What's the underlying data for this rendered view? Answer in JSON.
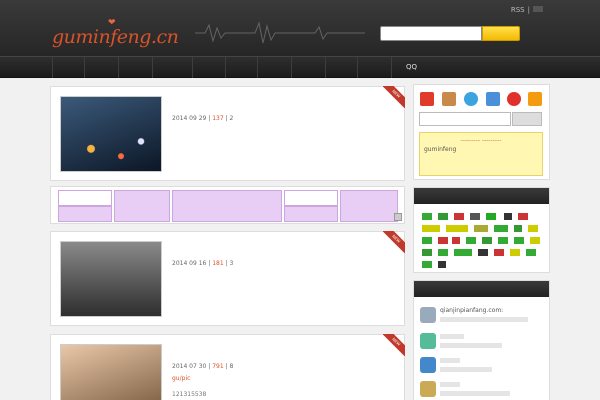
{
  "header": {
    "logo": "guminfeng.cn",
    "top_links": [
      "RSS",
      ""
    ],
    "search_value": "",
    "search_button": ""
  },
  "nav": {
    "items": [
      "",
      "",
      "",
      "",
      "",
      "",
      "",
      "",
      "",
      "",
      "QQ"
    ]
  },
  "posts": [
    {
      "title": "",
      "date": "2014 09 29",
      "views": "137",
      "comments": "2",
      "tag": "",
      "excerpt": ""
    },
    {
      "title": "",
      "date": "2014 09 16",
      "views": "181",
      "comments": "3",
      "tag": "",
      "excerpt": ""
    },
    {
      "title": "",
      "date": "2014 07 30",
      "views": "791",
      "comments": "8",
      "tag": "gu/pic",
      "excerpt": "121315538"
    }
  ],
  "strip": {
    "cells": [
      "",
      "",
      "",
      "",
      "",
      ""
    ]
  },
  "sidebar": {
    "notice_text": "guminfeng",
    "tag_cloud_title": "",
    "friends_title": "",
    "friends": [
      {
        "line1": "qianjinpianfang.com:",
        "line2": ""
      },
      {
        "line1": "",
        "line2": ""
      },
      {
        "line1": "",
        "line2": ""
      },
      {
        "line1": "",
        "line2": ""
      }
    ]
  },
  "colors": {
    "accent": "#d9532a",
    "header_bg": "#2a2a2a",
    "search_btn": "#f5c400",
    "strip_cell": "#e8cdf5",
    "notice_bg": "#fff7b2"
  }
}
